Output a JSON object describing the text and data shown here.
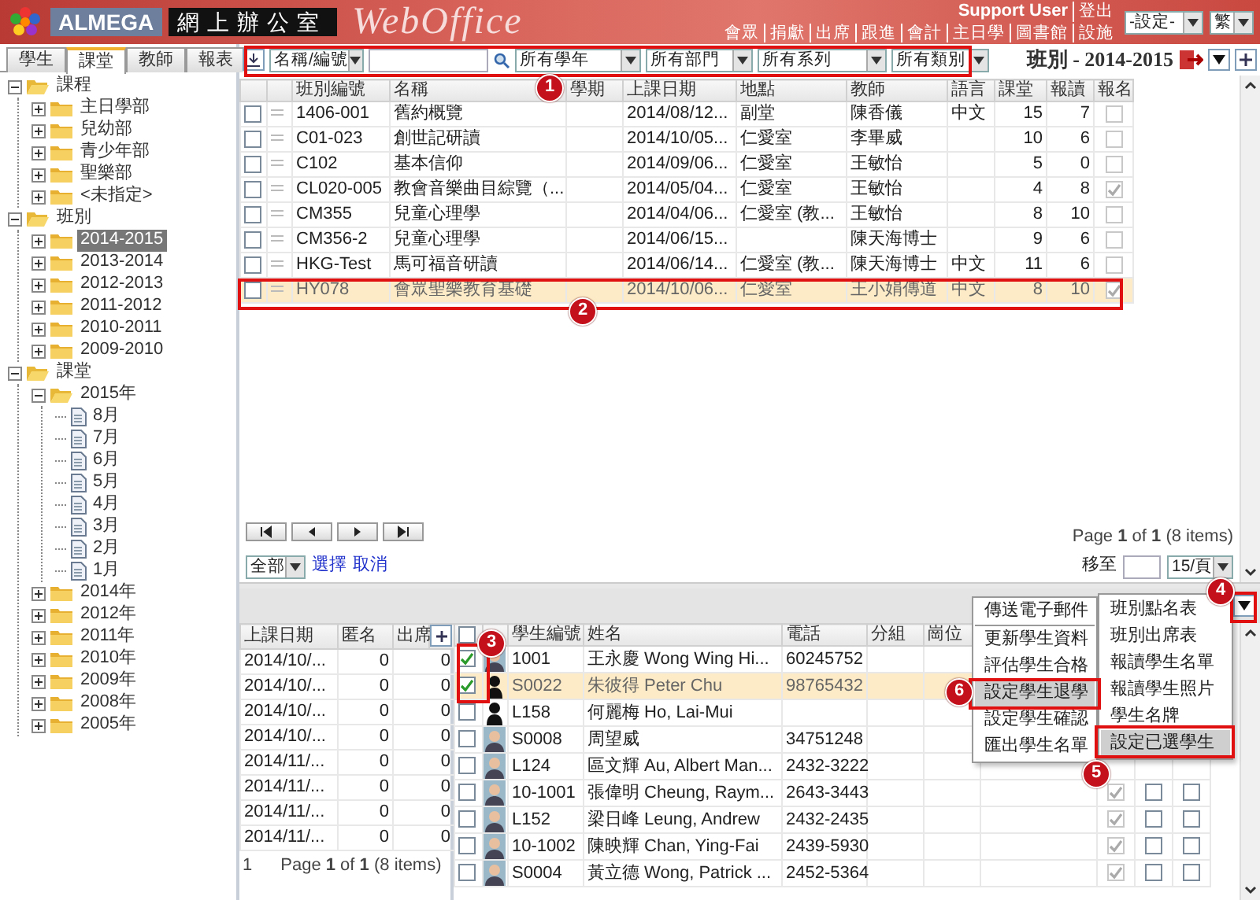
{
  "header": {
    "brand": "ALMEGA",
    "product": "網上辦公室",
    "logo_text": "WebOffice",
    "user": "Support User",
    "logout": "登出",
    "links": [
      "會眾",
      "捐獻",
      "出席",
      "跟進",
      "會計",
      "主日學",
      "圖書館",
      "設施"
    ],
    "settings_select": "-設定-",
    "language_select": "繁"
  },
  "sidebar": {
    "tabs": [
      {
        "label": "學生",
        "selected": false
      },
      {
        "label": "課堂",
        "selected": true
      },
      {
        "label": "教師",
        "selected": false
      },
      {
        "label": "報表",
        "selected": false
      }
    ],
    "tree": [
      {
        "label": "課程",
        "kind": "folder",
        "expanded": true,
        "selected": false,
        "children": [
          {
            "label": "主日學部",
            "kind": "folder",
            "expanded": false,
            "selected": false
          },
          {
            "label": "兒幼部",
            "kind": "folder",
            "expanded": false,
            "selected": false
          },
          {
            "label": "青少年部",
            "kind": "folder",
            "expanded": false,
            "selected": false
          },
          {
            "label": "聖樂部",
            "kind": "folder",
            "expanded": false,
            "selected": false
          },
          {
            "label": "<未指定>",
            "kind": "folder",
            "expanded": false,
            "selected": false
          }
        ]
      },
      {
        "label": "班別",
        "kind": "folder",
        "expanded": true,
        "selected": false,
        "children": [
          {
            "label": "2014-2015",
            "kind": "folder",
            "expanded": false,
            "selected": true
          },
          {
            "label": "2013-2014",
            "kind": "folder",
            "expanded": false,
            "selected": false
          },
          {
            "label": "2012-2013",
            "kind": "folder",
            "expanded": false,
            "selected": false
          },
          {
            "label": "2011-2012",
            "kind": "folder",
            "expanded": false,
            "selected": false
          },
          {
            "label": "2010-2011",
            "kind": "folder",
            "expanded": false,
            "selected": false
          },
          {
            "label": "2009-2010",
            "kind": "folder",
            "expanded": false,
            "selected": false
          }
        ]
      },
      {
        "label": "課堂",
        "kind": "folder",
        "expanded": true,
        "selected": false,
        "children": [
          {
            "label": "2015年",
            "kind": "folder",
            "expanded": true,
            "selected": false,
            "children": [
              {
                "label": "8月",
                "kind": "page",
                "selected": false
              },
              {
                "label": "7月",
                "kind": "page",
                "selected": false
              },
              {
                "label": "6月",
                "kind": "page",
                "selected": false
              },
              {
                "label": "5月",
                "kind": "page",
                "selected": false
              },
              {
                "label": "4月",
                "kind": "page",
                "selected": false
              },
              {
                "label": "3月",
                "kind": "page",
                "selected": false
              },
              {
                "label": "2月",
                "kind": "page",
                "selected": false
              },
              {
                "label": "1月",
                "kind": "page",
                "selected": false
              }
            ]
          },
          {
            "label": "2014年",
            "kind": "folder",
            "expanded": false,
            "selected": false
          },
          {
            "label": "2012年",
            "kind": "folder",
            "expanded": false,
            "selected": false
          },
          {
            "label": "2011年",
            "kind": "folder",
            "expanded": false,
            "selected": false
          },
          {
            "label": "2010年",
            "kind": "folder",
            "expanded": false,
            "selected": false
          },
          {
            "label": "2009年",
            "kind": "folder",
            "expanded": false,
            "selected": false
          },
          {
            "label": "2008年",
            "kind": "folder",
            "expanded": false,
            "selected": false
          },
          {
            "label": "2005年",
            "kind": "folder",
            "expanded": false,
            "selected": false
          }
        ]
      }
    ]
  },
  "toolbar": {
    "field_select": "名稱/編號",
    "filters": [
      "所有學年",
      "所有部門",
      "所有系列",
      "所有類別"
    ],
    "title": "班別 - 2014-2015"
  },
  "classes": {
    "columns": [
      "班別編號",
      "名稱",
      "學期",
      "上課日期",
      "地點",
      "教師",
      "語言",
      "課堂",
      "報讀",
      "報名"
    ],
    "rows": [
      {
        "code": "1406-001",
        "name": "舊約概覽",
        "date": "2014/08/12...",
        "place": "副堂",
        "teacher": "陳香儀",
        "language": "中文",
        "lessons": "15",
        "enrolments": "7",
        "registered": false,
        "selected": false
      },
      {
        "code": "C01-023",
        "name": "創世記研讀",
        "date": "2014/10/05...",
        "place": "仁愛室",
        "teacher": "李畢威",
        "lessons": "10",
        "enrolments": "6",
        "registered": false,
        "selected": false
      },
      {
        "code": "C102",
        "name": "基本信仰",
        "date": "2014/09/06...",
        "place": "仁愛室",
        "teacher": "王敏怡",
        "lessons": "5",
        "enrolments": "0",
        "registered": false,
        "selected": false
      },
      {
        "code": "CL020-005",
        "name": "教會音樂曲目綜覽（...",
        "date": "2014/05/04...",
        "place": "仁愛室",
        "teacher": "王敏怡",
        "lessons": "4",
        "enrolments": "8",
        "registered": true,
        "selected": false
      },
      {
        "code": "CM355",
        "name": "兒童心理學",
        "date": "2014/04/06...",
        "place": "仁愛室 (教...",
        "teacher": "王敏怡",
        "lessons": "8",
        "enrolments": "10",
        "registered": false,
        "selected": false
      },
      {
        "code": "CM356-2",
        "name": "兒童心理學",
        "date": "2014/06/15...",
        "teacher": "陳天海博士",
        "lessons": "9",
        "enrolments": "6",
        "registered": false,
        "selected": false
      },
      {
        "code": "HKG-Test",
        "name": "馬可福音研讀",
        "date": "2014/06/14...",
        "place": "仁愛室 (教...",
        "teacher": "陳天海博士",
        "language": "中文",
        "lessons": "11",
        "enrolments": "6",
        "registered": false,
        "selected": false
      },
      {
        "code": "HY078",
        "name": "會眾聖樂教育基礎",
        "date": "2014/10/06...",
        "place": "仁愛室",
        "teacher": "王小娟傳道",
        "language": "中文",
        "lessons": "8",
        "enrolments": "10",
        "registered": true,
        "selected": true
      }
    ],
    "pager_info": "Page **1** of **1** (8 items)",
    "scope_select": "全部",
    "select_link": "選擇",
    "cancel_link": "取消",
    "goto_label": "移至",
    "page_size_select": "15/頁"
  },
  "attendance": {
    "columns": [
      "上課日期",
      "匿名",
      "出席"
    ],
    "rows": [
      [
        "2014/10/...",
        "0",
        "0"
      ],
      [
        "2014/10/...",
        "0",
        "0"
      ],
      [
        "2014/10/...",
        "0",
        "0"
      ],
      [
        "2014/10/...",
        "0",
        "0"
      ],
      [
        "2014/11/...",
        "0",
        "0"
      ],
      [
        "2014/11/...",
        "0",
        "0"
      ],
      [
        "2014/11/...",
        "0",
        "0"
      ],
      [
        "2014/11/...",
        "0",
        "0"
      ]
    ],
    "pager_page": "1",
    "pager_info": "Page **1** of **1** (8 items)"
  },
  "students": {
    "all_checked": false,
    "columns": [
      "學生編號",
      "姓名",
      "電話",
      "分組",
      "崗位"
    ],
    "rows": [
      {
        "id": "1001",
        "name": "王永慶 Wong Wing Hi...",
        "phone": "60245752",
        "kind": "photo",
        "checked": true,
        "selected": false
      },
      {
        "id": "S0022",
        "name": "朱彼得 Peter Chu",
        "phone": "98765432",
        "kind": "silhouette",
        "checked": true,
        "selected": true
      },
      {
        "id": "L158",
        "name": "何麗梅 Ho, Lai-Mui",
        "kind": "silhouette",
        "checked": false,
        "selected": false
      },
      {
        "id": "S0008",
        "name": "周望威",
        "phone": "34751248",
        "kind": "photo",
        "checked": false,
        "selected": false
      },
      {
        "id": "L124",
        "name": "區文輝 Au, Albert Man...",
        "phone": "2432-3222",
        "kind": "photo",
        "checked": false,
        "selected": false
      },
      {
        "id": "10-1001",
        "name": "張偉明 Cheung, Raym...",
        "phone": "2643-3443",
        "kind": "photo",
        "checked": false,
        "selected": false,
        "flags": [
          true,
          false,
          false
        ]
      },
      {
        "id": "L152",
        "name": "梁日峰 Leung, Andrew",
        "phone": "2432-2435",
        "kind": "photo",
        "checked": false,
        "selected": false,
        "flags": [
          true,
          false,
          false
        ]
      },
      {
        "id": "10-1002",
        "name": "陳映輝 Chan, Ying-Fai",
        "phone": "2439-5930",
        "kind": "photo",
        "checked": false,
        "selected": false,
        "flags": [
          true,
          false,
          false
        ]
      },
      {
        "id": "S0004",
        "name": "黃立德 Wong, Patrick ...",
        "phone": "2452-5364",
        "kind": "photo",
        "checked": false,
        "selected": false,
        "flags": [
          true,
          false,
          false
        ]
      }
    ]
  },
  "action_menu": {
    "items": [
      {
        "label": "傳送電子郵件",
        "selected": false,
        "separator_after": true
      },
      {
        "label": "更新學生資料",
        "selected": false,
        "separator_after": false
      },
      {
        "label": "評估學生合格",
        "selected": false,
        "separator_after": false
      },
      {
        "label": "設定學生退學",
        "selected": true,
        "separator_after": false
      },
      {
        "label": "設定學生確認",
        "selected": false,
        "separator_after": false
      },
      {
        "label": "匯出學生名單",
        "selected": false,
        "separator_after": false
      }
    ]
  },
  "report_menu": {
    "items": [
      {
        "label": "班別點名表",
        "selected": false
      },
      {
        "label": "班別出席表",
        "selected": false
      },
      {
        "label": "報讀學生名單",
        "selected": false
      },
      {
        "label": "報讀學生照片",
        "selected": false
      },
      {
        "label": "學生名牌",
        "selected": false
      },
      {
        "label": "設定已選學生",
        "selected": true
      }
    ]
  },
  "callouts": [
    {
      "label": "1"
    },
    {
      "label": "2"
    },
    {
      "label": "3"
    },
    {
      "label": "4"
    },
    {
      "label": "5"
    },
    {
      "label": "6"
    }
  ]
}
